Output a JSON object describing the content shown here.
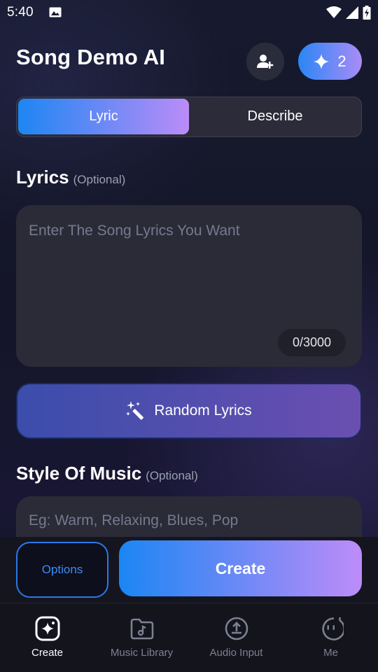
{
  "status_bar": {
    "time": "5:40"
  },
  "header": {
    "title": "Song Demo AI",
    "credits": "2"
  },
  "tabs": [
    {
      "label": "Lyric",
      "active": true
    },
    {
      "label": "Describe",
      "active": false
    }
  ],
  "lyrics": {
    "heading": "Lyrics",
    "optional": "(Optional)",
    "placeholder": "Enter The Song Lyrics You Want",
    "counter": "0/3000"
  },
  "random_button": {
    "label": "Random Lyrics"
  },
  "style": {
    "heading": "Style Of Music",
    "optional": "(Optional)",
    "placeholder": "Eg: Warm, Relaxing, Blues, Pop"
  },
  "actions": {
    "options_label": "Options",
    "create_label": "Create"
  },
  "bottom_nav": [
    {
      "label": "Create",
      "icon": "sparkle-icon",
      "active": true
    },
    {
      "label": "Music Library",
      "icon": "music-folder-icon",
      "active": false
    },
    {
      "label": "Audio Input",
      "icon": "upload-icon",
      "active": false
    },
    {
      "label": "Me",
      "icon": "face-icon",
      "active": false
    }
  ],
  "colors": {
    "accent_blue": "#1d86f3",
    "accent_purple": "#bb8cf8",
    "options_blue": "#3a8cf5"
  }
}
